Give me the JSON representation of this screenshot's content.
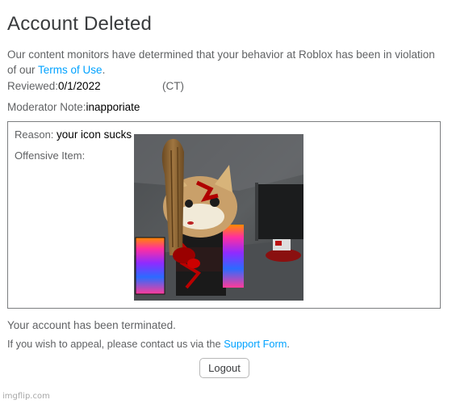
{
  "page": {
    "title": "Account Deleted",
    "message_before_link": "Our content monitors have determined that your behavior at Roblox has been in violation of our ",
    "terms_link": "Terms of Use",
    "message_after_link": "."
  },
  "reviewed": {
    "label": "Reviewed:",
    "value": "0/1/2022",
    "timezone": "(CT)"
  },
  "moderator_note": {
    "label": "Moderator Note:",
    "value": "inapporiate"
  },
  "violation_box": {
    "reason_label": "Reason:",
    "reason_value": "your icon sucks",
    "offensive_item_label": "Offensive Item:"
  },
  "footer": {
    "terminated_text": "Your account has been terminated.",
    "appeal_before_link": "If you wish to appeal, please contact us via the ",
    "support_link": "Support Form",
    "appeal_after_link": ".",
    "logout_label": "Logout"
  },
  "watermark": "imgflip.com",
  "colors": {
    "link": "#00a2ff",
    "text_gray": "#606264",
    "title": "#393b3d",
    "border": "#7c7e80"
  }
}
